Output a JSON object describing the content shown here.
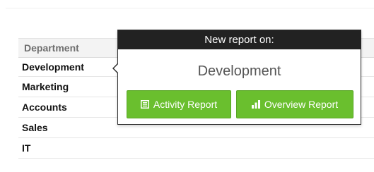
{
  "table": {
    "header": "Department",
    "rows": [
      "Development",
      "Marketing",
      "Accounts",
      "Sales",
      "IT"
    ]
  },
  "popover": {
    "header": "New report on:",
    "title": "Development",
    "buttons": {
      "activity": {
        "label": "Activity Report",
        "icon": "list-icon"
      },
      "overview": {
        "label": "Overview Report",
        "icon": "bar-chart-icon"
      }
    }
  },
  "colors": {
    "button_green": "#6abf2e",
    "popover_header": "#222222"
  }
}
